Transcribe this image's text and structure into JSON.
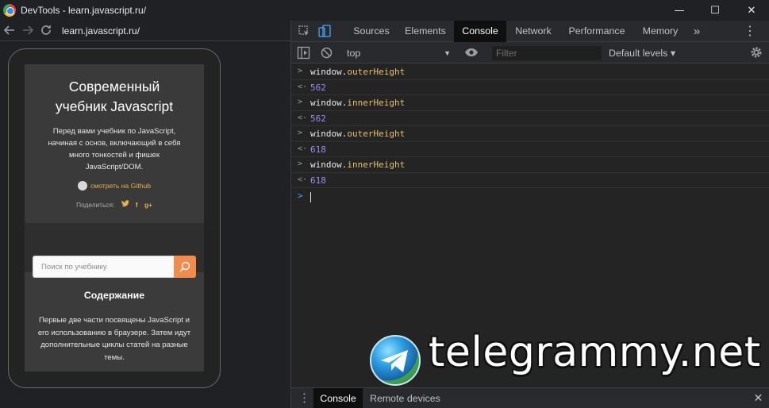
{
  "window": {
    "title": "DevTools - learn.javascript.ru/",
    "controls": {
      "minimize": "—",
      "maximize": "☐",
      "close": "✕"
    }
  },
  "browser": {
    "address": "learn.javascript.ru/",
    "icons": [
      "back-arrow-icon",
      "forward-arrow-icon",
      "reload-icon"
    ]
  },
  "site": {
    "title_line1": "Современный",
    "title_line2": "учебник Javascript",
    "intro_lines": [
      "Перед вами учебник по JavaScript,",
      "начиная с основ, включающий в себя",
      "много тонкостей и фишек",
      "JavaScript/DOM."
    ],
    "github_link": "смотреть на Github",
    "share_label": "Поделиться:",
    "share_icons": [
      "twitter-icon",
      "facebook-icon",
      "google-plus-icon"
    ],
    "search_placeholder": "Поиск по учебнику",
    "contents_title": "Содержание",
    "contents_lines": [
      "Первые две части посвящены JavaScript и",
      "его использованию в браузере. Затем идут",
      "дополнительные циклы статей на разные",
      "темы."
    ]
  },
  "devtools": {
    "tabs": [
      {
        "label": "Sources",
        "active": false
      },
      {
        "label": "Elements",
        "active": false
      },
      {
        "label": "Console",
        "active": true
      },
      {
        "label": "Network",
        "active": false
      },
      {
        "label": "Performance",
        "active": false
      },
      {
        "label": "Memory",
        "active": false
      }
    ],
    "more_tabs": "»",
    "menu": "⋮",
    "toolbar": {
      "context": "top",
      "filter_placeholder": "Filter",
      "levels": "Default levels ▾"
    },
    "console": [
      {
        "input": "window.",
        "prop": "outerHeight",
        "output": "562"
      },
      {
        "input": "window.",
        "prop": "innerHeight",
        "output": "562"
      },
      {
        "input": "window.",
        "prop": "outerHeight",
        "output": "618"
      },
      {
        "input": "window.",
        "prop": "innerHeight",
        "output": "618"
      }
    ],
    "drawer": {
      "active_tab": "Console",
      "other_tab": "Remote devices",
      "close": "✕"
    }
  },
  "watermark": "telegrammy.net",
  "colors": {
    "accent_orange": "#f38b4b",
    "link_gold": "#e8b04c",
    "console_number": "#9a8cf0",
    "console_property": "#e2c070"
  }
}
